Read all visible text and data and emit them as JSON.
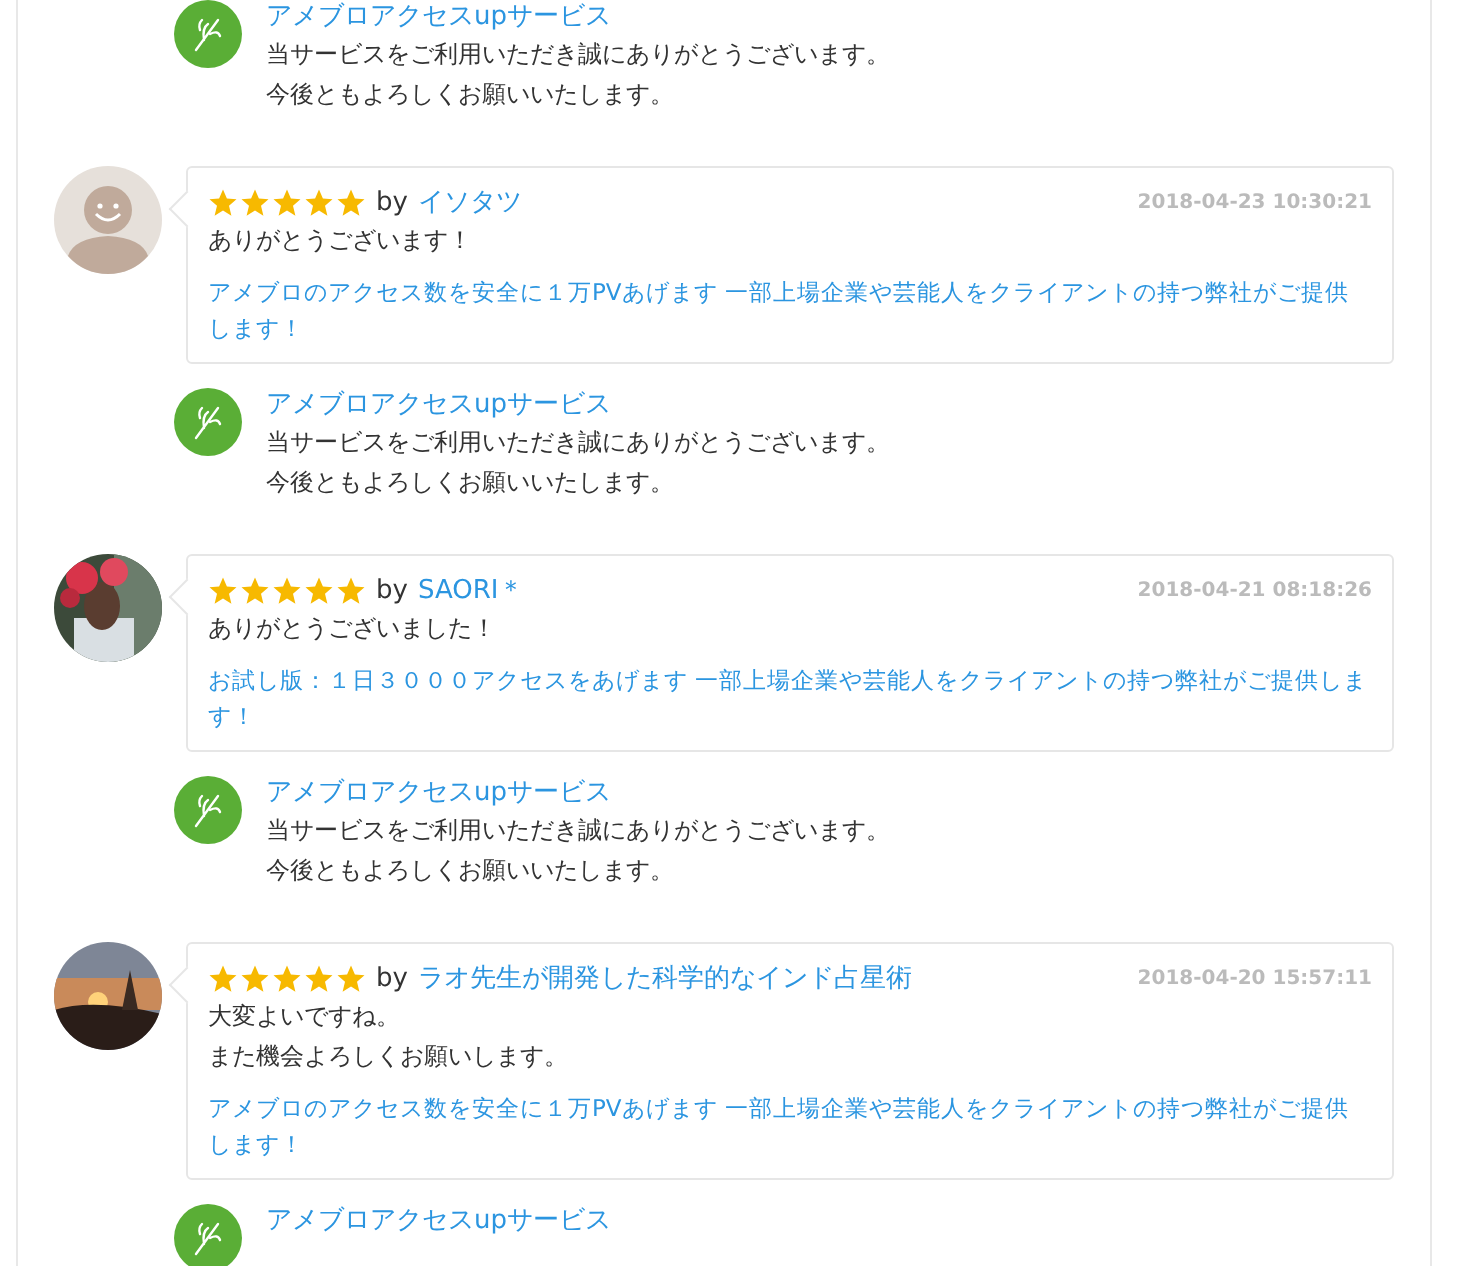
{
  "entries": [
    {
      "kind": "reply",
      "seller": "アメブロアクセスupサービス",
      "lines": [
        "当サービスをご利用いただき誠にありがとうございます。",
        "今後ともよろしくお願いいたします。"
      ]
    },
    {
      "kind": "review",
      "avatar": {
        "kind": "silhouette"
      },
      "stars": 5,
      "by": "by",
      "user": "イソタツ",
      "date": "2018-04-23 10:30:21",
      "comment": [
        "ありがとうございます！"
      ],
      "service": "アメブロのアクセス数を安全に１万PVあげます 一部上場企業や芸能人をクライアントの持つ弊社がご提供します！"
    },
    {
      "kind": "reply",
      "seller": "アメブロアクセスupサービス",
      "lines": [
        "当サービスをご利用いただき誠にありがとうございます。",
        "今後ともよろしくお願いいたします。"
      ]
    },
    {
      "kind": "review",
      "avatar": {
        "kind": "picture"
      },
      "stars": 5,
      "by": "by",
      "user": "SAORI＊",
      "date": "2018-04-21 08:18:26",
      "comment": [
        "ありがとうございました！"
      ],
      "service": "お試し版：１日３０００アクセスをあげます 一部上場企業や芸能人をクライアントの持つ弊社がご提供します！"
    },
    {
      "kind": "reply",
      "seller": "アメブロアクセスupサービス",
      "lines": [
        "当サービスをご利用いただき誠にありがとうございます。",
        "今後ともよろしくお願いいたします。"
      ]
    },
    {
      "kind": "review",
      "avatar": {
        "kind": "picture"
      },
      "stars": 5,
      "by": "by",
      "user": "ラオ先生が開発した科学的なインド占星術",
      "date": "2018-04-20 15:57:11",
      "comment": [
        "大変よいですね。",
        "また機会よろしくお願いします。"
      ],
      "service": "アメブロのアクセス数を安全に１万PVあげます 一部上場企業や芸能人をクライアントの持つ弊社がご提供します！"
    },
    {
      "kind": "reply",
      "seller": "アメブロアクセスupサービス"
    }
  ]
}
